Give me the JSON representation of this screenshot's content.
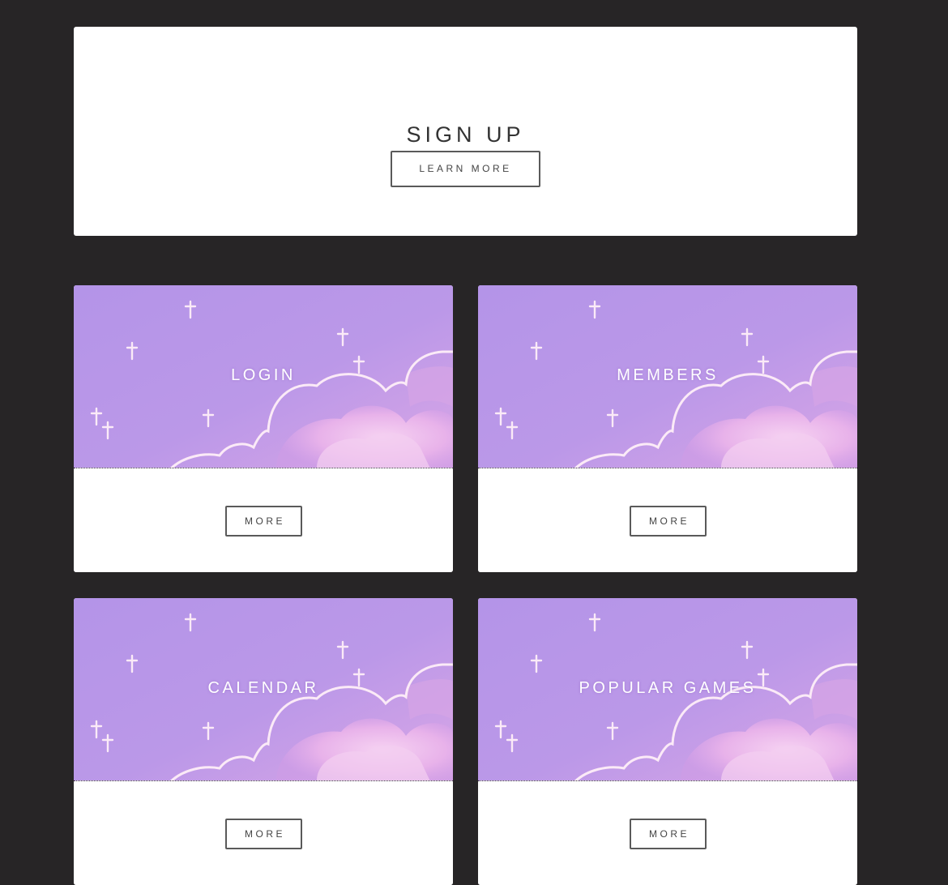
{
  "signup": {
    "title": "SIGN UP",
    "button_label": "LEARN MORE"
  },
  "tiles": [
    {
      "label": "LOGIN",
      "button_label": "MORE"
    },
    {
      "label": "MEMBERS",
      "button_label": "MORE"
    },
    {
      "label": "CALENDAR",
      "button_label": "MORE"
    },
    {
      "label": "POPULAR GAMES",
      "button_label": "MORE"
    }
  ],
  "colors": {
    "page_background": "#272526",
    "card_background": "#ffffff",
    "banner_purple": "#b394e6",
    "banner_pink": "#e8b6ea",
    "button_border": "#5a5a5a"
  }
}
